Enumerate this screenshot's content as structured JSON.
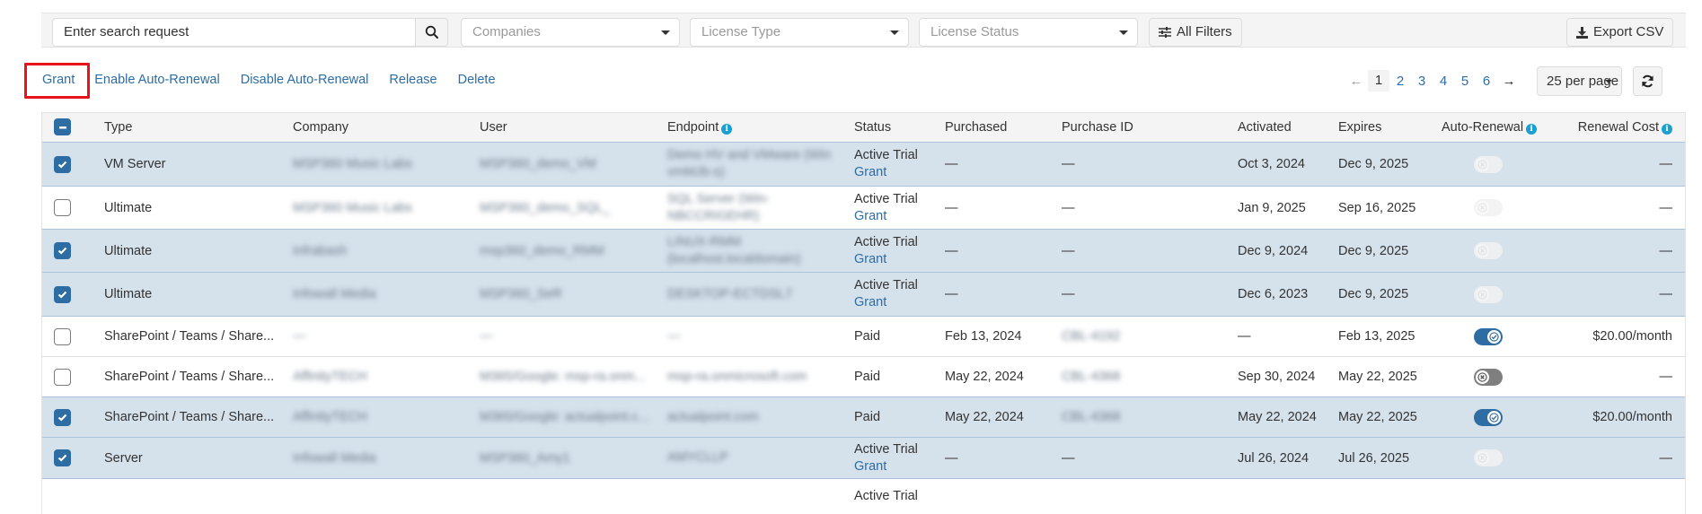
{
  "filters": {
    "search_placeholder": "Enter search request",
    "companies_placeholder": "Companies",
    "license_type_placeholder": "License Type",
    "license_status_placeholder": "License Status",
    "all_filters_label": "All Filters",
    "export_label": "Export CSV"
  },
  "actions": [
    {
      "label": "Grant",
      "highlighted": true
    },
    {
      "label": "Enable Auto-Renewal"
    },
    {
      "label": "Disable Auto-Renewal"
    },
    {
      "label": "Release"
    },
    {
      "label": "Delete"
    }
  ],
  "pagination": {
    "prev": "←",
    "next": "→",
    "pages": [
      "1",
      "2",
      "3",
      "4",
      "5",
      "6"
    ],
    "current": "1",
    "per_page_label": "25 per page"
  },
  "table": {
    "columns": [
      "Type",
      "Company",
      "User",
      "Endpoint",
      "Status",
      "Purchased",
      "Purchase ID",
      "Activated",
      "Expires",
      "Auto-Renewal",
      "Renewal Cost"
    ],
    "header_select_state": "indeterminate",
    "rows": [
      {
        "selected": true,
        "type": "VM Server",
        "company": "MSP360 Music Labs",
        "user": "MSP360_demo_VM",
        "endpoint": [
          "Demo HV and VMware (Win",
          "vmMJb-s)"
        ],
        "status": "Active Trial",
        "grant_link": "Grant",
        "purchased": "—",
        "purchase_id": "—",
        "activated": "Oct 3, 2024",
        "expires": "Dec 9, 2025",
        "auto_renewal": "disabled",
        "renewal_cost": "—"
      },
      {
        "selected": false,
        "type": "Ultimate",
        "company": "MSP360 Music Labs",
        "user": "MSP360_demo_SQL_",
        "endpoint": [
          "SQL Server (Win-",
          "NBCCRIGEHR)"
        ],
        "status": "Active Trial",
        "grant_link": "Grant",
        "purchased": "—",
        "purchase_id": "—",
        "activated": "Jan 9, 2025",
        "expires": "Sep 16, 2025",
        "auto_renewal": "disabled",
        "renewal_cost": "—"
      },
      {
        "selected": true,
        "type": "Ultimate",
        "company": "Infrabash",
        "user": "msp360_demo_RMM",
        "endpoint": [
          "LINUX-RMM",
          "(localhost.localdomain)"
        ],
        "status": "Active Trial",
        "grant_link": "Grant",
        "purchased": "—",
        "purchase_id": "—",
        "activated": "Dec 9, 2024",
        "expires": "Dec 9, 2025",
        "auto_renewal": "disabled",
        "renewal_cost": "—"
      },
      {
        "selected": true,
        "type": "Ultimate",
        "company": "Infowall Media",
        "user": "MSP360_SeR",
        "endpoint": [
          "DESKTOP-ECTDSL7"
        ],
        "status": "Active Trial",
        "grant_link": "Grant",
        "purchased": "—",
        "purchase_id": "—",
        "activated": "Dec 6, 2023",
        "expires": "Dec 9, 2025",
        "auto_renewal": "disabled",
        "renewal_cost": "—"
      },
      {
        "selected": false,
        "type": "SharePoint / Teams / Share...",
        "company": "—",
        "user": "—",
        "endpoint": [
          "—"
        ],
        "status": "Paid",
        "grant_link": "",
        "purchased": "Feb 13, 2024",
        "purchase_id": "CBL-4192",
        "activated": "—",
        "expires": "Feb 13, 2025",
        "auto_renewal": "on",
        "renewal_cost": "$20.00/month"
      },
      {
        "selected": false,
        "type": "SharePoint / Teams / Share...",
        "company": "AffinityTECH",
        "user": "M365/Google: msp-ra.onm...",
        "endpoint": [
          "msp-ra.onmicrosoft.com"
        ],
        "status": "Paid",
        "grant_link": "",
        "purchased": "May 22, 2024",
        "purchase_id": "CBL-4368",
        "activated": "Sep 30, 2024",
        "expires": "May 22, 2025",
        "auto_renewal": "off",
        "renewal_cost": "—"
      },
      {
        "selected": true,
        "type": "SharePoint / Teams / Share...",
        "company": "AffinityTECH",
        "user": "M365/Google: actualpoint.c...",
        "endpoint": [
          "actualpoint.com"
        ],
        "status": "Paid",
        "grant_link": "",
        "purchased": "May 22, 2024",
        "purchase_id": "CBL-4368",
        "activated": "May 22, 2024",
        "expires": "May 22, 2025",
        "auto_renewal": "on",
        "renewal_cost": "$20.00/month"
      },
      {
        "selected": true,
        "type": "Server",
        "company": "Infowall Media",
        "user": "MSP360_Amy1",
        "endpoint": [
          "AMYCLLP"
        ],
        "status": "Active Trial",
        "grant_link": "Grant",
        "purchased": "—",
        "purchase_id": "—",
        "activated": "Jul 26, 2024",
        "expires": "Jul 26, 2025",
        "auto_renewal": "disabled",
        "renewal_cost": "—"
      },
      {
        "selected": false,
        "type": "",
        "company": "",
        "user": "",
        "endpoint": [
          ""
        ],
        "status": "Active Trial",
        "grant_link": "",
        "purchased": "",
        "purchase_id": "",
        "activated": "",
        "expires": "",
        "auto_renewal": "none",
        "renewal_cost": ""
      }
    ]
  },
  "colors": {
    "accent": "#2e6da4",
    "selected_row": "#d5e1eb",
    "highlight_box": "#e8141b",
    "info_icon": "#1a9fd0"
  }
}
